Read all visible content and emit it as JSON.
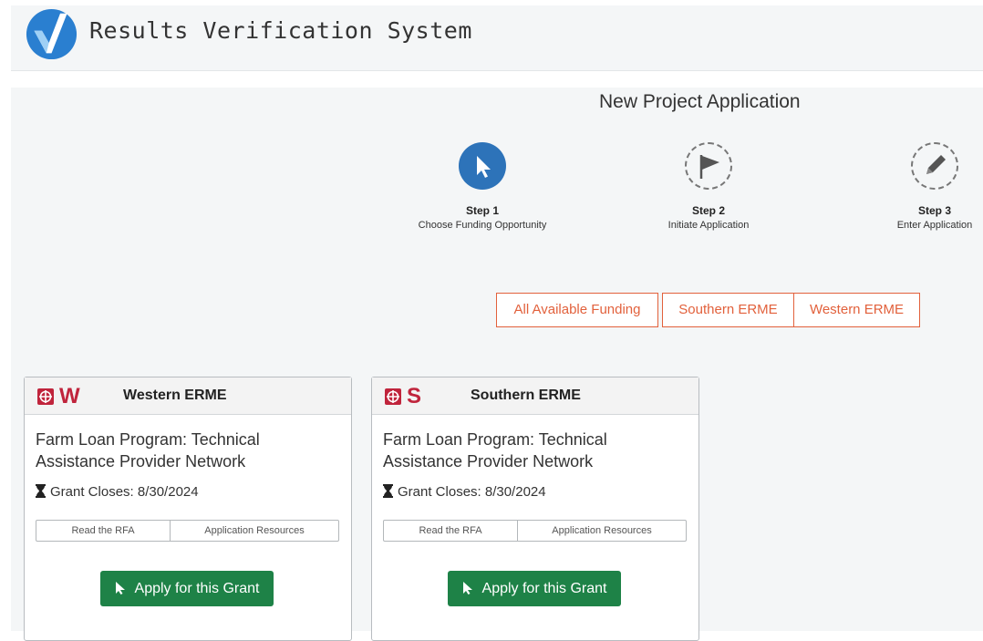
{
  "app": {
    "title": "Results Verification System",
    "logo_icon": "checkmark-v-logo"
  },
  "page": {
    "title": "New Project Application"
  },
  "steps": [
    {
      "label": "Step 1",
      "description": "Choose Funding Opportunity",
      "icon": "cursor-pointer-icon",
      "state": "active"
    },
    {
      "label": "Step 2",
      "description": "Initiate Application",
      "icon": "flag-icon",
      "state": "pending"
    },
    {
      "label": "Step 3",
      "description": "Enter Application",
      "icon": "pencil-icon",
      "state": "pending"
    }
  ],
  "filters": [
    {
      "label": "All Available Funding"
    },
    {
      "label": "Southern ERME"
    },
    {
      "label": "Western ERME"
    }
  ],
  "cards": [
    {
      "badge_letter": "W",
      "region": "Western ERME",
      "title": "Farm Loan Program: Technical Assistance Provider Network",
      "closes": "Grant Closes: 8/30/2024",
      "links": [
        "Read the RFA",
        "Application Resources"
      ],
      "apply_label": "Apply for this Grant"
    },
    {
      "badge_letter": "S",
      "region": "Southern ERME",
      "title": "Farm Loan Program: Technical Assistance Provider Network",
      "closes": "Grant Closes: 8/30/2024",
      "links": [
        "Read the RFA",
        "Application Resources"
      ],
      "apply_label": "Apply for this Grant"
    }
  ],
  "colors": {
    "step_active": "#2d73b9",
    "filter_accent": "#e2613c",
    "apply_button": "#1e8247",
    "badge": "#c0243c"
  }
}
